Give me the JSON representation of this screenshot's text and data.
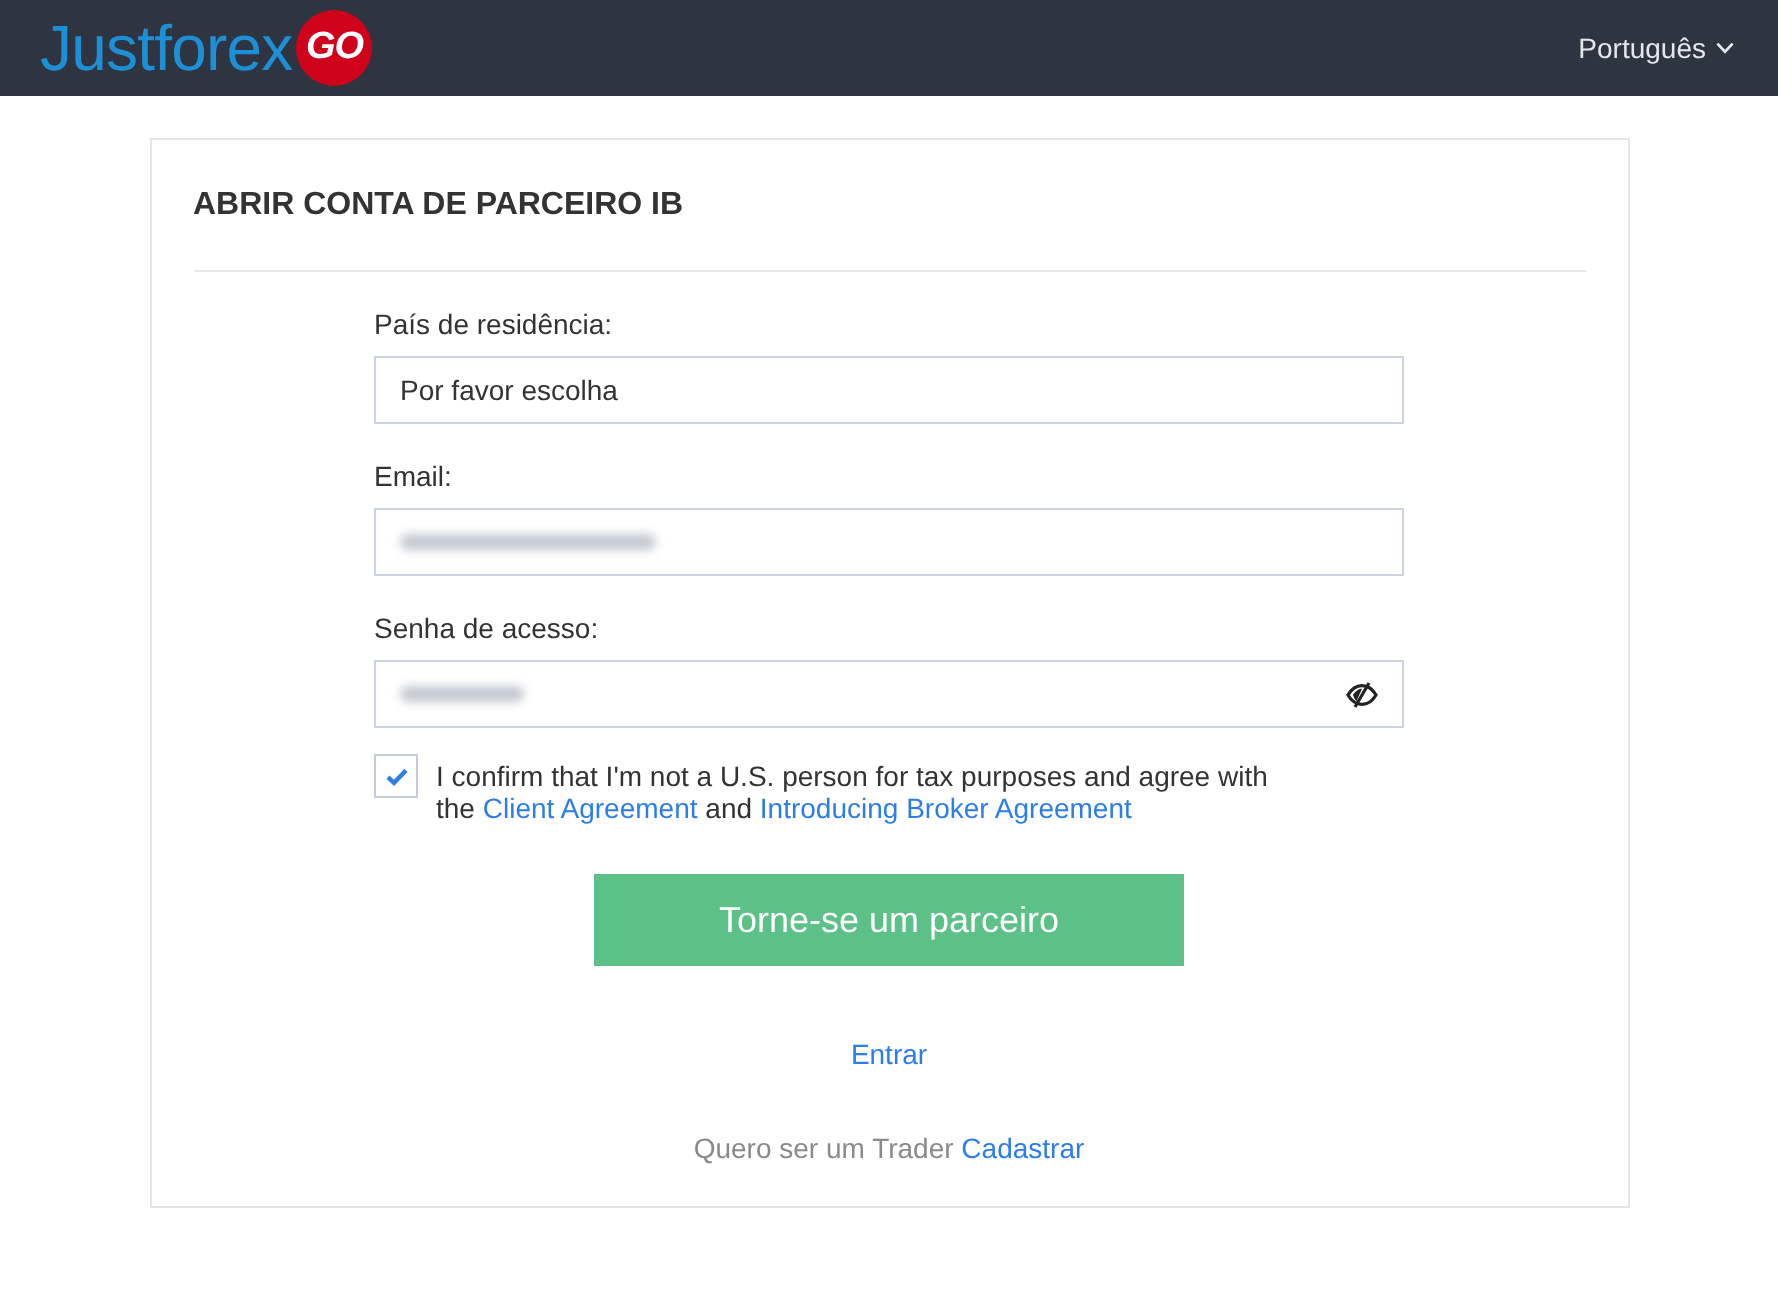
{
  "header": {
    "logo": {
      "text": "Justforex",
      "badge": "GO"
    },
    "language": "Português"
  },
  "form": {
    "title": "ABRIR CONTA DE PARCEIRO IB",
    "fields": [
      {
        "kind": "select",
        "label": "País de residência:",
        "value": "Por favor escolha",
        "redacted": false
      },
      {
        "kind": "email",
        "label": "Email:",
        "redacted": true
      },
      {
        "kind": "password",
        "label": "Senha de acesso:",
        "redacted": true
      }
    ],
    "agreement": {
      "checked": true,
      "parts": [
        {
          "kind": "text",
          "text": "I confirm that I'm not a U.S. person for tax purposes and agree with the"
        },
        {
          "kind": "link",
          "text": "Client Agreement"
        },
        {
          "kind": "text",
          "text": "and"
        },
        {
          "kind": "link",
          "text": "Introducing Broker Agreement"
        }
      ]
    },
    "submit_button": "Torne-se um parceiro",
    "login_link": "Entrar",
    "footer": {
      "text": "Quero ser um Trader",
      "link": "Cadastrar"
    }
  }
}
